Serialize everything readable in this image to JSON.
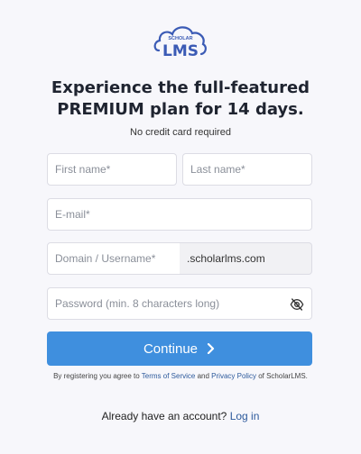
{
  "logo": {
    "top_text": "SCHOLAR",
    "main_text": "LMS"
  },
  "headline": {
    "line1": "Experience the full-featured",
    "line2": "PREMIUM plan for 14 days."
  },
  "subtitle": "No credit card required",
  "form": {
    "first_name_placeholder": "First name*",
    "last_name_placeholder": "Last name*",
    "email_placeholder": "E-mail*",
    "domain_placeholder": "Domain / Username*",
    "domain_suffix": ".scholarlms.com",
    "password_placeholder": "Password (min. 8 characters long)"
  },
  "continue_label": "Continue",
  "terms": {
    "prefix": "By registering you agree to",
    "tos_link": "Terms of Service",
    "and": "and",
    "privacy_link": "Privacy Policy",
    "suffix": "of ScholarLMS."
  },
  "login": {
    "prompt": "Already have an account?",
    "link": "Log in"
  },
  "colors": {
    "accent": "#3f8fde",
    "brand": "#3b5bb5",
    "link": "#2d5a9c"
  },
  "icons": {
    "password_toggle": "eye-off-icon",
    "continue_arrow": "chevron-right-icon"
  }
}
